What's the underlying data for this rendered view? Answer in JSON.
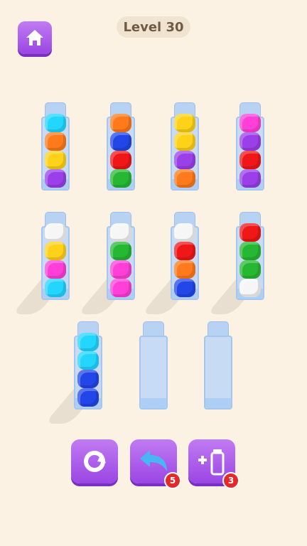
{
  "header": {
    "level_label": "Level 30",
    "home_icon": "home-icon"
  },
  "colors": {
    "cyan": "#22d6ff",
    "orange": "#ff7a1a",
    "yellow": "#ffd21a",
    "purple": "#9b3fe8",
    "blue": "#2346e8",
    "red": "#ef1717",
    "green": "#27b833",
    "magenta": "#ff3fd8",
    "white": "#f6f6f6"
  },
  "tubes": [
    {
      "balls": [
        "purple",
        "yellow",
        "orange",
        "cyan"
      ]
    },
    {
      "balls": [
        "green",
        "red",
        "blue",
        "orange"
      ]
    },
    {
      "balls": [
        "orange",
        "purple",
        "yellow",
        "yellow"
      ]
    },
    {
      "balls": [
        "purple",
        "red",
        "purple",
        "magenta"
      ]
    },
    {
      "balls": [
        "cyan",
        "magenta",
        "yellow",
        "white"
      ]
    },
    {
      "balls": [
        "magenta",
        "magenta",
        "green",
        "white"
      ]
    },
    {
      "balls": [
        "blue",
        "orange",
        "red",
        "white"
      ]
    },
    {
      "balls": [
        "white",
        "green",
        "green",
        "red"
      ]
    },
    {
      "balls": [
        "blue",
        "blue",
        "cyan",
        "cyan"
      ]
    },
    {
      "balls": []
    },
    {
      "balls": []
    }
  ],
  "actions": {
    "restart": {
      "icon": "restart-icon"
    },
    "undo": {
      "icon": "undo-arrow-icon",
      "count": "5"
    },
    "add_tube": {
      "icon": "add-tube-icon",
      "count": "3"
    }
  }
}
